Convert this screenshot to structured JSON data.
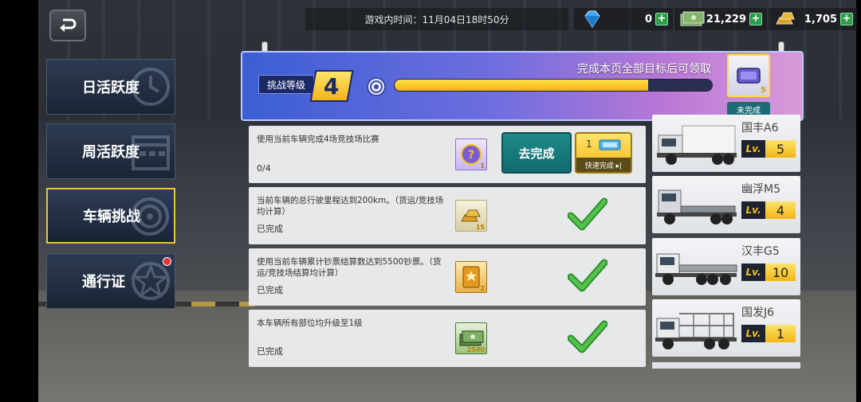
{
  "top_bar": {
    "game_time": "游戏内时间：11月04日18时50分",
    "currencies": [
      {
        "icon": "diamond-icon",
        "value": "0"
      },
      {
        "icon": "cash-icon",
        "value": "21,229"
      },
      {
        "icon": "gold-bar-icon",
        "value": "1,705"
      }
    ]
  },
  "sidebar": {
    "tabs": [
      {
        "label": "日活跃度",
        "icon": "daily-clock-icon"
      },
      {
        "label": "周活跃度",
        "icon": "weekly-calendar-icon"
      },
      {
        "label": "车辆挑战",
        "icon": "target-icon"
      },
      {
        "label": "通行证",
        "icon": "star-badge-icon"
      }
    ],
    "active_index": 2
  },
  "header": {
    "level_label": "挑战等级",
    "level": "4",
    "progress_fraction": 0.8,
    "reward_text": "完成本页全部目标后可领取",
    "reward_count": "5",
    "reward_status": "未完成"
  },
  "tasks": [
    {
      "desc": "使用当前车辆完成4场竞技场比赛",
      "status": "0/4",
      "item_count": "1",
      "item_icon": "mystery-box-icon",
      "completed": false
    },
    {
      "desc": "当前车辆的总行驶里程达到200km。（货运/竞技场均计算）",
      "status": "已完成",
      "item_count": "15",
      "item_icon": "gold-bar-icon",
      "completed": true
    },
    {
      "desc": "使用当前车辆累计钞票结算数达到5500钞票。（货运/竞技场结算均计算）",
      "status": "已完成",
      "item_count": "2",
      "item_icon": "star-card-icon",
      "completed": true
    },
    {
      "desc": "本车辆所有部位均升级至1级",
      "status": "已完成",
      "item_count": "2500",
      "item_icon": "cash-icon",
      "completed": true
    }
  ],
  "task_actions": {
    "go_label": "去完成",
    "quick_count": "1",
    "quick_label": "快速完成 ▸|"
  },
  "vehicles": [
    {
      "name": "国丰A6",
      "lv_label": "Lv.",
      "level": "5"
    },
    {
      "name": "幽浮M5",
      "lv_label": "Lv.",
      "level": "4"
    },
    {
      "name": "汉丰G5",
      "lv_label": "Lv.",
      "level": "10"
    },
    {
      "name": "国发J6",
      "lv_label": "Lv.",
      "level": "1"
    }
  ],
  "colors": {
    "accent_gold": "#f4b41a",
    "banner_blue": "#3b5ed3",
    "teal_button": "#1f8b8a",
    "check_green": "#3aa83a"
  }
}
